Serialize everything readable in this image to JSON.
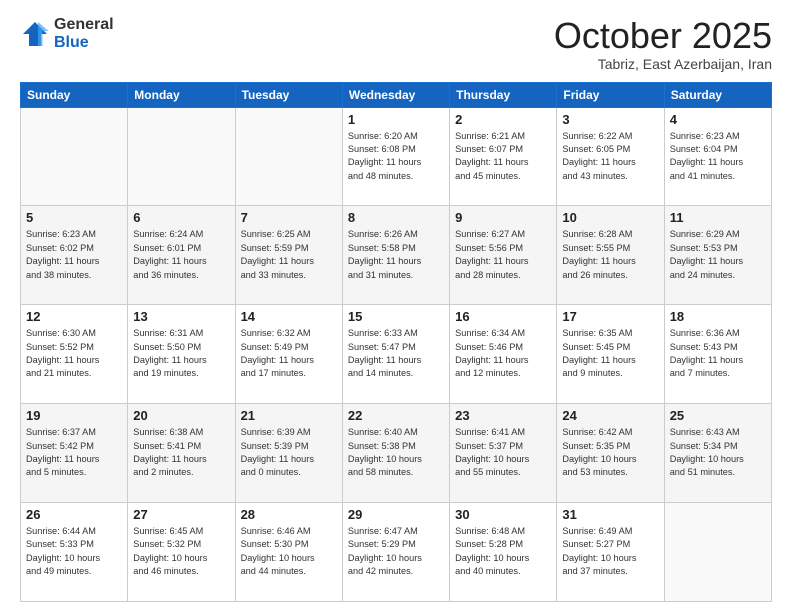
{
  "header": {
    "logo_line1": "General",
    "logo_line2": "Blue",
    "month": "October 2025",
    "location": "Tabriz, East Azerbaijan, Iran"
  },
  "days_of_week": [
    "Sunday",
    "Monday",
    "Tuesday",
    "Wednesday",
    "Thursday",
    "Friday",
    "Saturday"
  ],
  "weeks": [
    [
      {
        "day": "",
        "info": ""
      },
      {
        "day": "",
        "info": ""
      },
      {
        "day": "",
        "info": ""
      },
      {
        "day": "1",
        "info": "Sunrise: 6:20 AM\nSunset: 6:08 PM\nDaylight: 11 hours\nand 48 minutes."
      },
      {
        "day": "2",
        "info": "Sunrise: 6:21 AM\nSunset: 6:07 PM\nDaylight: 11 hours\nand 45 minutes."
      },
      {
        "day": "3",
        "info": "Sunrise: 6:22 AM\nSunset: 6:05 PM\nDaylight: 11 hours\nand 43 minutes."
      },
      {
        "day": "4",
        "info": "Sunrise: 6:23 AM\nSunset: 6:04 PM\nDaylight: 11 hours\nand 41 minutes."
      }
    ],
    [
      {
        "day": "5",
        "info": "Sunrise: 6:23 AM\nSunset: 6:02 PM\nDaylight: 11 hours\nand 38 minutes."
      },
      {
        "day": "6",
        "info": "Sunrise: 6:24 AM\nSunset: 6:01 PM\nDaylight: 11 hours\nand 36 minutes."
      },
      {
        "day": "7",
        "info": "Sunrise: 6:25 AM\nSunset: 5:59 PM\nDaylight: 11 hours\nand 33 minutes."
      },
      {
        "day": "8",
        "info": "Sunrise: 6:26 AM\nSunset: 5:58 PM\nDaylight: 11 hours\nand 31 minutes."
      },
      {
        "day": "9",
        "info": "Sunrise: 6:27 AM\nSunset: 5:56 PM\nDaylight: 11 hours\nand 28 minutes."
      },
      {
        "day": "10",
        "info": "Sunrise: 6:28 AM\nSunset: 5:55 PM\nDaylight: 11 hours\nand 26 minutes."
      },
      {
        "day": "11",
        "info": "Sunrise: 6:29 AM\nSunset: 5:53 PM\nDaylight: 11 hours\nand 24 minutes."
      }
    ],
    [
      {
        "day": "12",
        "info": "Sunrise: 6:30 AM\nSunset: 5:52 PM\nDaylight: 11 hours\nand 21 minutes."
      },
      {
        "day": "13",
        "info": "Sunrise: 6:31 AM\nSunset: 5:50 PM\nDaylight: 11 hours\nand 19 minutes."
      },
      {
        "day": "14",
        "info": "Sunrise: 6:32 AM\nSunset: 5:49 PM\nDaylight: 11 hours\nand 17 minutes."
      },
      {
        "day": "15",
        "info": "Sunrise: 6:33 AM\nSunset: 5:47 PM\nDaylight: 11 hours\nand 14 minutes."
      },
      {
        "day": "16",
        "info": "Sunrise: 6:34 AM\nSunset: 5:46 PM\nDaylight: 11 hours\nand 12 minutes."
      },
      {
        "day": "17",
        "info": "Sunrise: 6:35 AM\nSunset: 5:45 PM\nDaylight: 11 hours\nand 9 minutes."
      },
      {
        "day": "18",
        "info": "Sunrise: 6:36 AM\nSunset: 5:43 PM\nDaylight: 11 hours\nand 7 minutes."
      }
    ],
    [
      {
        "day": "19",
        "info": "Sunrise: 6:37 AM\nSunset: 5:42 PM\nDaylight: 11 hours\nand 5 minutes."
      },
      {
        "day": "20",
        "info": "Sunrise: 6:38 AM\nSunset: 5:41 PM\nDaylight: 11 hours\nand 2 minutes."
      },
      {
        "day": "21",
        "info": "Sunrise: 6:39 AM\nSunset: 5:39 PM\nDaylight: 11 hours\nand 0 minutes."
      },
      {
        "day": "22",
        "info": "Sunrise: 6:40 AM\nSunset: 5:38 PM\nDaylight: 10 hours\nand 58 minutes."
      },
      {
        "day": "23",
        "info": "Sunrise: 6:41 AM\nSunset: 5:37 PM\nDaylight: 10 hours\nand 55 minutes."
      },
      {
        "day": "24",
        "info": "Sunrise: 6:42 AM\nSunset: 5:35 PM\nDaylight: 10 hours\nand 53 minutes."
      },
      {
        "day": "25",
        "info": "Sunrise: 6:43 AM\nSunset: 5:34 PM\nDaylight: 10 hours\nand 51 minutes."
      }
    ],
    [
      {
        "day": "26",
        "info": "Sunrise: 6:44 AM\nSunset: 5:33 PM\nDaylight: 10 hours\nand 49 minutes."
      },
      {
        "day": "27",
        "info": "Sunrise: 6:45 AM\nSunset: 5:32 PM\nDaylight: 10 hours\nand 46 minutes."
      },
      {
        "day": "28",
        "info": "Sunrise: 6:46 AM\nSunset: 5:30 PM\nDaylight: 10 hours\nand 44 minutes."
      },
      {
        "day": "29",
        "info": "Sunrise: 6:47 AM\nSunset: 5:29 PM\nDaylight: 10 hours\nand 42 minutes."
      },
      {
        "day": "30",
        "info": "Sunrise: 6:48 AM\nSunset: 5:28 PM\nDaylight: 10 hours\nand 40 minutes."
      },
      {
        "day": "31",
        "info": "Sunrise: 6:49 AM\nSunset: 5:27 PM\nDaylight: 10 hours\nand 37 minutes."
      },
      {
        "day": "",
        "info": ""
      }
    ]
  ]
}
